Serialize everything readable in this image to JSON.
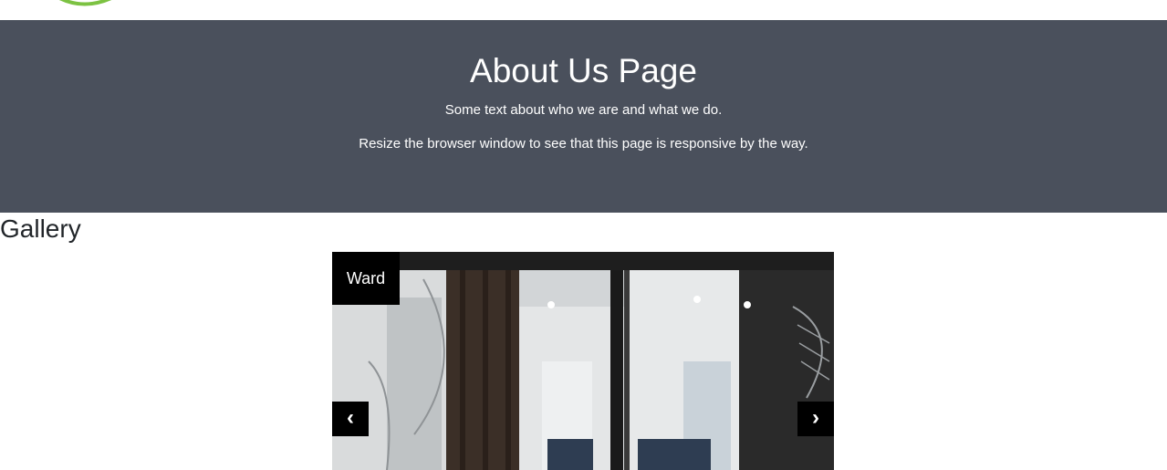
{
  "header": {
    "logo_icon": "leaf-swoosh-logo"
  },
  "hero": {
    "title": "About Us Page",
    "line1": "Some text about who we are and what we do.",
    "line2": "Resize the browser window to see that this page is responsive by the way."
  },
  "gallery": {
    "title": "Gallery",
    "slide_caption": "Ward",
    "prev_label": "‹",
    "next_label": "›",
    "prev_icon": "chevron-left-icon",
    "next_icon": "chevron-right-icon",
    "image_subject": "hospital-ward-photo"
  },
  "colors": {
    "hero_bg": "#4a505c",
    "logo_green": "#7cc242",
    "caption_bg": "#000000"
  }
}
